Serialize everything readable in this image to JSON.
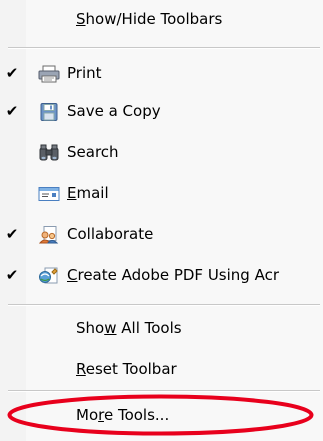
{
  "menu": {
    "show_hide_toolbars": {
      "pre": "",
      "ul": "S",
      "post": "how/Hide Toolbars"
    },
    "items": [
      {
        "checked": true,
        "icon": "printer-icon",
        "label_pre": "",
        "label_ul": "",
        "label_post": "Print"
      },
      {
        "checked": true,
        "icon": "floppy-disk-icon",
        "label_pre": "",
        "label_ul": "",
        "label_post": "Save a Copy"
      },
      {
        "checked": false,
        "icon": "binoculars-icon",
        "label_pre": "",
        "label_ul": "",
        "label_post": "Search"
      },
      {
        "checked": false,
        "icon": "email-icon",
        "label_pre": "",
        "label_ul": "E",
        "label_post": "mail"
      },
      {
        "checked": true,
        "icon": "collaborate-icon",
        "label_pre": "",
        "label_ul": "",
        "label_post": "Collaborate"
      },
      {
        "checked": true,
        "icon": "create-pdf-icon",
        "label_pre": "",
        "label_ul": "C",
        "label_post": "reate Adobe PDF Using Acr"
      }
    ],
    "check_glyph": "✔",
    "show_all_tools": {
      "pre": "Sho",
      "ul": "w",
      "post": " All Tools"
    },
    "reset_toolbar": {
      "pre": "",
      "ul": "R",
      "post": "eset Toolbar"
    },
    "more_tools": {
      "pre": "Mo",
      "ul": "r",
      "post": "e Tools..."
    }
  },
  "colors": {
    "highlight_ellipse": "#e8001c",
    "menu_background": "#f8f8f8"
  }
}
